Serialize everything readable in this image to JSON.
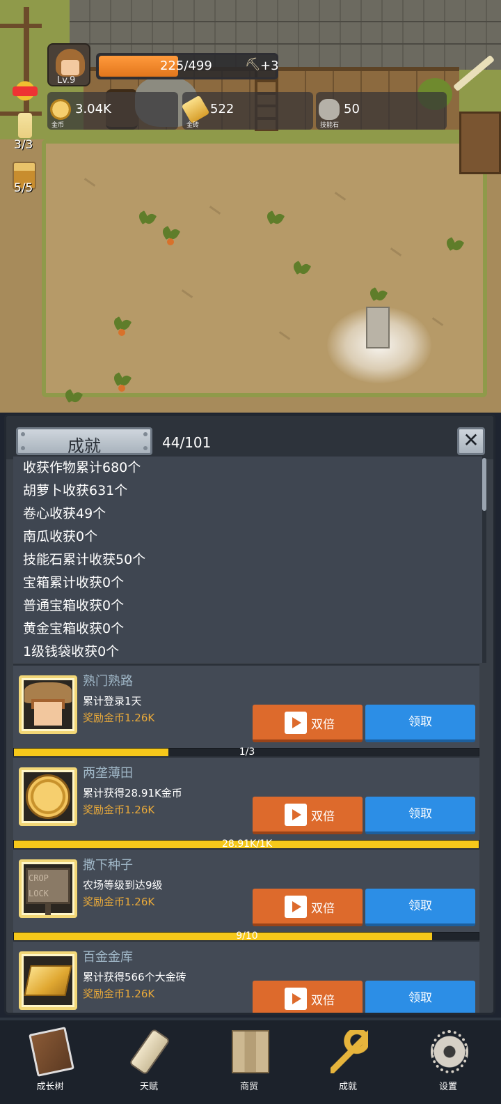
{
  "hud": {
    "level": "Lv.9",
    "xp_text": "225/499",
    "xp_progress": 0.45,
    "xp_bonus": "+3",
    "resources": [
      {
        "icon": "gold-coin-icon",
        "value": "3.04K",
        "caption": "金币"
      },
      {
        "icon": "gold-brick-icon",
        "value": "522",
        "caption": "金砖"
      },
      {
        "icon": "skill-stone-icon",
        "value": "50",
        "caption": "技能石"
      }
    ],
    "candle_count": "3/3",
    "mug_count": "5/5"
  },
  "panel": {
    "title": "成就",
    "count": "44/101",
    "stats": [
      "收获作物累计680个",
      "胡萝卜收获631个",
      "卷心收获49个",
      "南瓜收获0个",
      "技能石累计收获50个",
      "宝箱累计收获0个",
      "普通宝箱收获0个",
      "黄金宝箱收获0个",
      "1级钱袋收获0个"
    ],
    "achievements": [
      {
        "name": "熟门熟路",
        "desc": "累计登录1天",
        "reward": "奖励金币1.26K",
        "double_label": "双倍",
        "claim_label": "领取",
        "progress_text": "1/3",
        "progress": 0.333,
        "icon": "farmer-boy-icon"
      },
      {
        "name": "两垄薄田",
        "desc": "累计获得28.91K金币",
        "reward": "奖励金币1.26K",
        "double_label": "双倍",
        "claim_label": "领取",
        "progress_text": "28.91K/1K",
        "progress": 1.0,
        "icon": "gold-coin-icon"
      },
      {
        "name": "撒下种子",
        "desc": "农场等级到达9级",
        "reward": "奖励金币1.26K",
        "double_label": "双倍",
        "claim_label": "领取",
        "progress_text": "9/10",
        "progress": 0.9,
        "icon": "crop-lock-sign-icon",
        "icon_text": [
          "CROP",
          "LOCK"
        ]
      },
      {
        "name": "百金金库",
        "desc": "累计获得566个大金砖",
        "reward": "奖励金币1.26K",
        "double_label": "双倍",
        "claim_label": "领取",
        "icon": "gold-bar-icon"
      }
    ]
  },
  "nav": [
    {
      "label": "成长树",
      "icon": "book-icon"
    },
    {
      "label": "天赋",
      "icon": "scroll-icon"
    },
    {
      "label": "商贸",
      "icon": "map-icon"
    },
    {
      "label": "成就",
      "icon": "key-icon"
    },
    {
      "label": "设置",
      "icon": "gear-icon"
    }
  ],
  "colors": {
    "xp_bar": "#f08a2c",
    "double_button": "#dd6a2c",
    "claim_button": "#2c8ee6",
    "progress_fill": "#f6c81a",
    "reward_text": "#e8a93a"
  }
}
